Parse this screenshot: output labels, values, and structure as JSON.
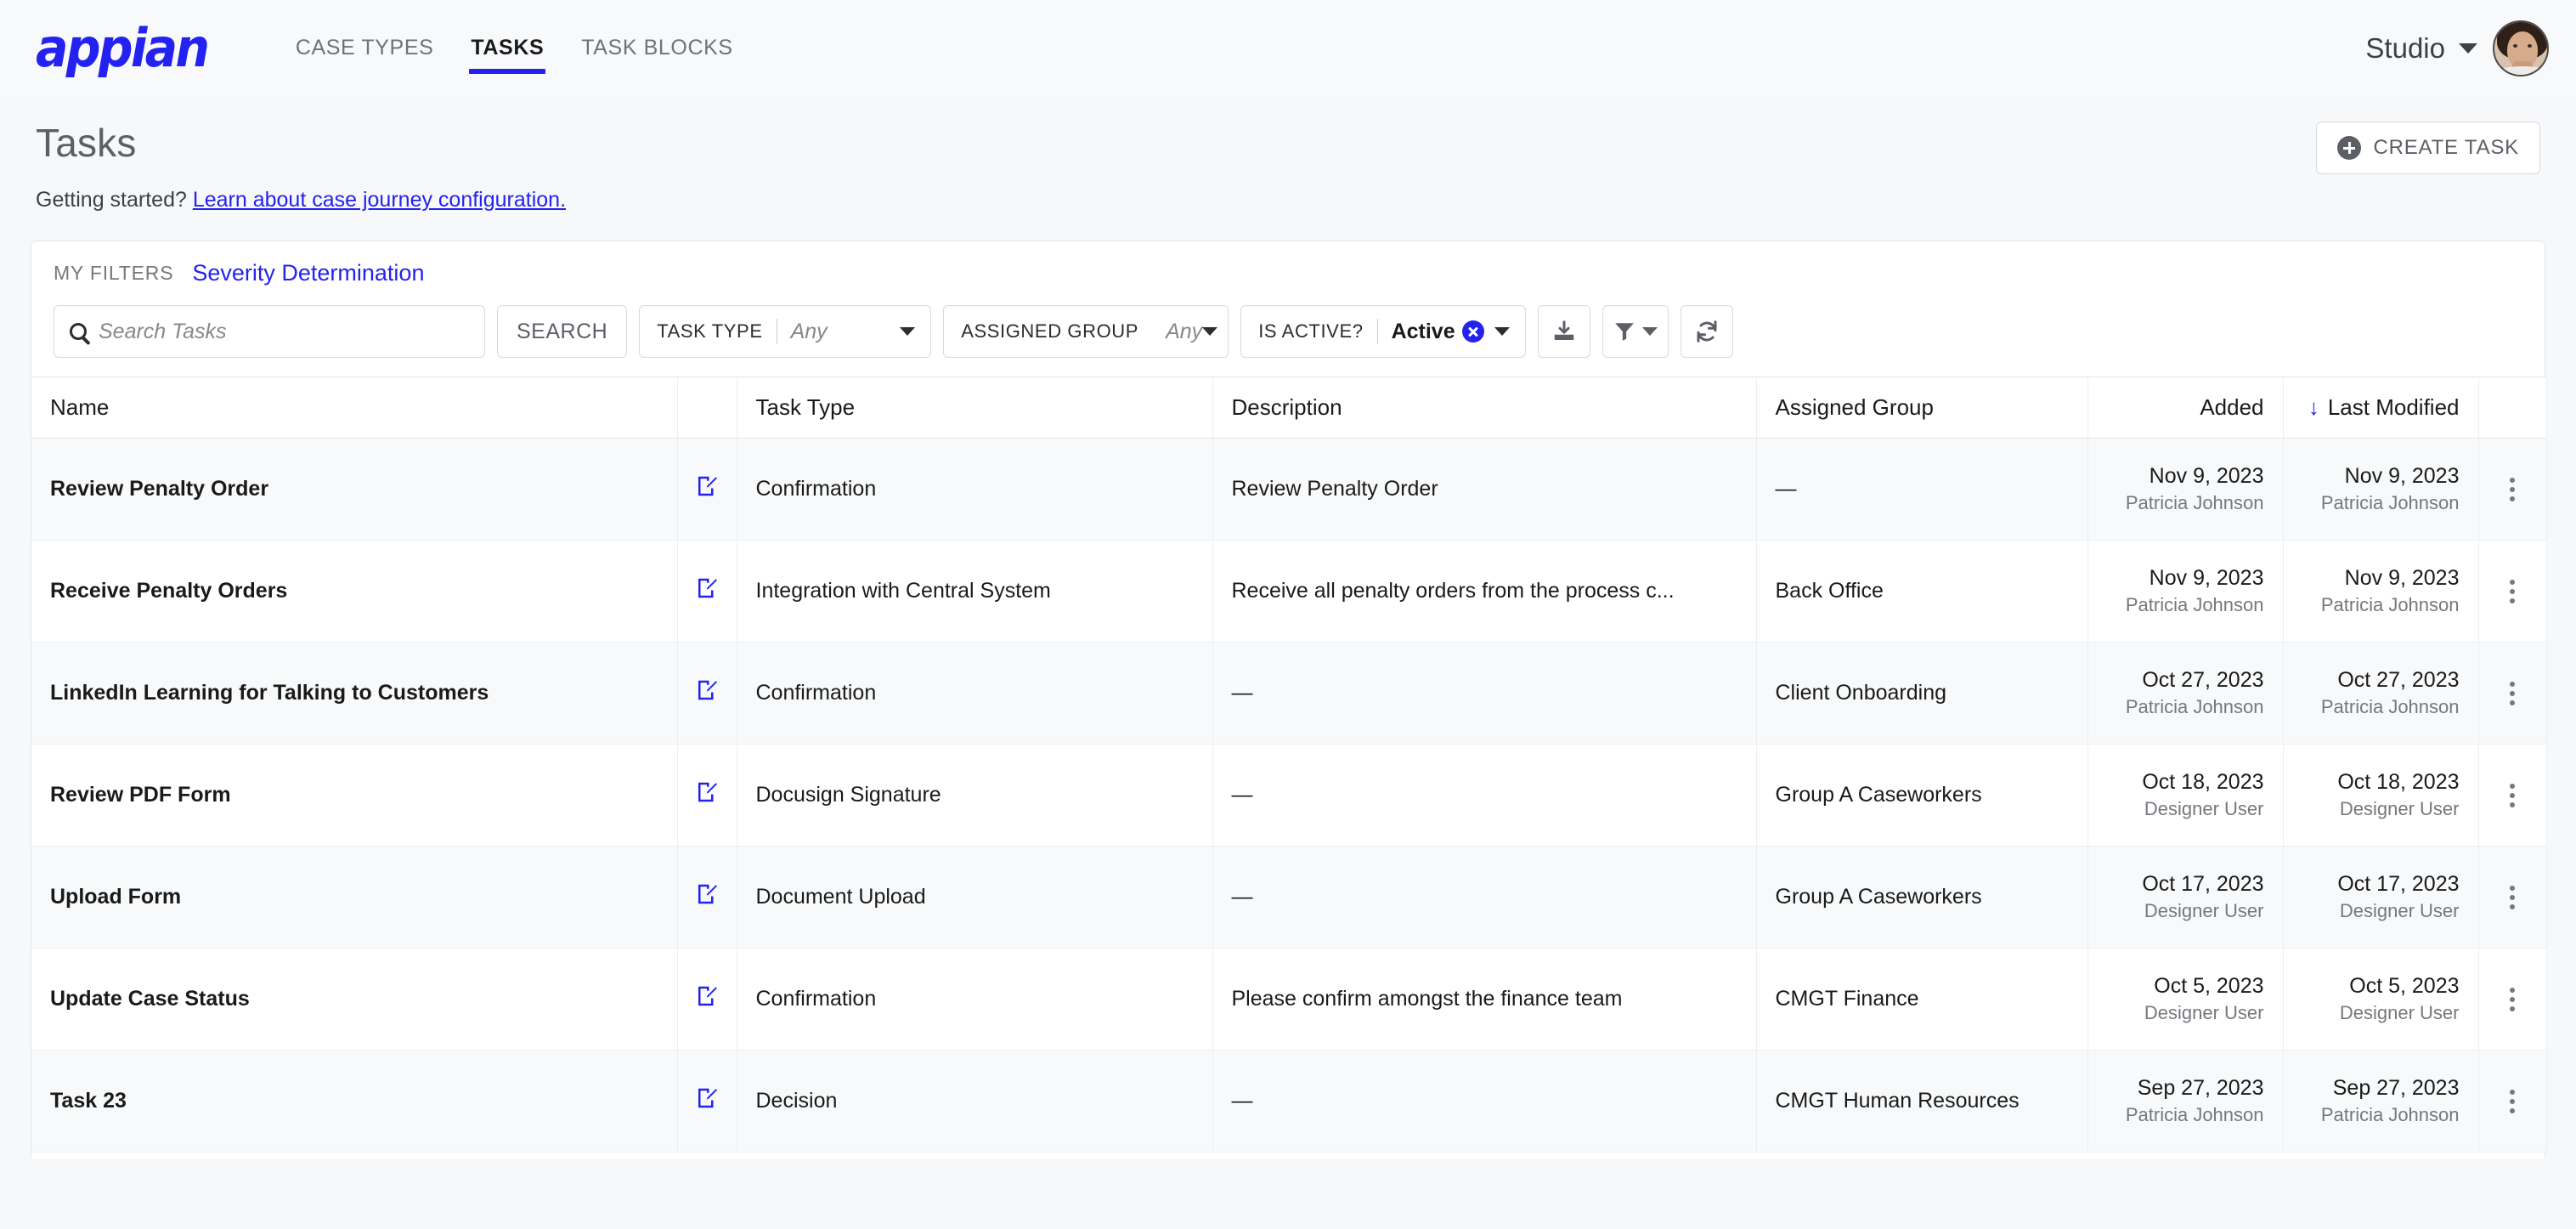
{
  "brand": {
    "logo_text": "appian",
    "accent": "#2322f0"
  },
  "nav": {
    "tabs": [
      {
        "label": "CASE TYPES",
        "active": false
      },
      {
        "label": "TASKS",
        "active": true
      },
      {
        "label": "TASK BLOCKS",
        "active": false
      }
    ],
    "account_label": "Studio"
  },
  "page": {
    "title": "Tasks",
    "getting_started_prefix": "Getting started? ",
    "getting_started_link": "Learn about case journey configuration.",
    "create_button": "CREATE TASK"
  },
  "filters": {
    "my_filters_label": "MY FILTERS",
    "saved_filter": "Severity Determination",
    "search_placeholder": "Search Tasks",
    "search_value": "",
    "search_button": "SEARCH",
    "task_type": {
      "label": "TASK TYPE",
      "value": "Any",
      "is_set": false
    },
    "assigned_group": {
      "label": "ASSIGNED GROUP",
      "value": "Any",
      "is_set": false
    },
    "is_active": {
      "label": "IS ACTIVE?",
      "value": "Active",
      "is_set": true
    },
    "export_icon": "download-icon",
    "funnel_icon": "filter-funnel-icon",
    "refresh_icon": "refresh-icon"
  },
  "table": {
    "columns": [
      {
        "label": "Name",
        "align": "left"
      },
      {
        "label": "",
        "align": "center"
      },
      {
        "label": "Task Type",
        "align": "left"
      },
      {
        "label": "Description",
        "align": "left"
      },
      {
        "label": "Assigned Group",
        "align": "left"
      },
      {
        "label": "Added",
        "align": "right"
      },
      {
        "label": "Last Modified",
        "align": "right"
      },
      {
        "label": "",
        "align": "center"
      }
    ],
    "sorted_column": "Last Modified",
    "sort_direction": "descending",
    "sort_glyph": "↓",
    "empty_value": "—",
    "rows": [
      {
        "name": "Review Penalty Order",
        "task_type": "Confirmation",
        "description": "Review Penalty Order",
        "assigned_group": "—",
        "added_date": "Nov 9, 2023",
        "added_user": "Patricia Johnson",
        "modified_date": "Nov 9, 2023",
        "modified_user": "Patricia Johnson"
      },
      {
        "name": "Receive Penalty Orders",
        "task_type": "Integration with Central System",
        "description": "Receive all penalty orders from the process c...",
        "assigned_group": "Back Office",
        "added_date": "Nov 9, 2023",
        "added_user": "Patricia Johnson",
        "modified_date": "Nov 9, 2023",
        "modified_user": "Patricia Johnson"
      },
      {
        "name": "LinkedIn Learning for Talking to Customers",
        "task_type": "Confirmation",
        "description": "—",
        "assigned_group": "Client Onboarding",
        "added_date": "Oct 27, 2023",
        "added_user": "Patricia Johnson",
        "modified_date": "Oct 27, 2023",
        "modified_user": "Patricia Johnson"
      },
      {
        "name": "Review PDF Form",
        "task_type": "Docusign Signature",
        "description": "—",
        "assigned_group": "Group A Caseworkers",
        "added_date": "Oct 18, 2023",
        "added_user": "Designer User",
        "modified_date": "Oct 18, 2023",
        "modified_user": "Designer User"
      },
      {
        "name": "Upload Form",
        "task_type": "Document Upload",
        "description": "—",
        "assigned_group": "Group A Caseworkers",
        "added_date": "Oct 17, 2023",
        "added_user": "Designer User",
        "modified_date": "Oct 17, 2023",
        "modified_user": "Designer User"
      },
      {
        "name": "Update Case Status",
        "task_type": "Confirmation",
        "description": "Please confirm amongst the finance team",
        "assigned_group": "CMGT Finance",
        "added_date": "Oct 5, 2023",
        "added_user": "Designer User",
        "modified_date": "Oct 5, 2023",
        "modified_user": "Designer User"
      },
      {
        "name": "Task 23",
        "task_type": "Decision",
        "description": "—",
        "assigned_group": "CMGT Human Resources",
        "added_date": "Sep 27, 2023",
        "added_user": "Patricia Johnson",
        "modified_date": "Sep 27, 2023",
        "modified_user": "Patricia Johnson"
      }
    ]
  }
}
